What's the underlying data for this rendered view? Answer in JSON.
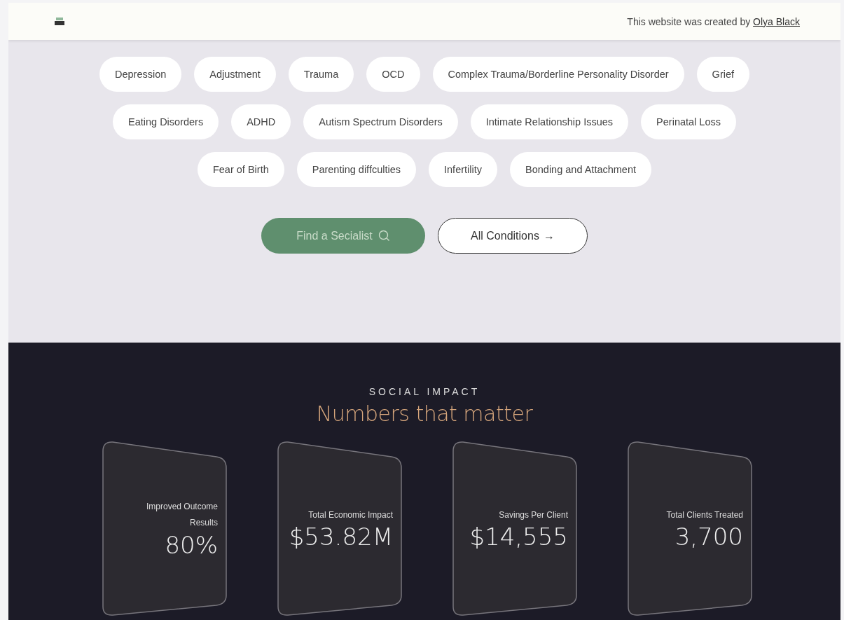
{
  "header": {
    "credit": "This website was created by",
    "credit_link": "Olya Black"
  },
  "conditions": {
    "tags": [
      "Depression",
      "Adjustment",
      "Trauma",
      "OCD",
      "Complex Trauma/Borderline Personality Disorder",
      "Grief",
      "Eating Disorders",
      "ADHD",
      "Autism Spectrum Disorders",
      "Intimate Relationship Issues",
      "Perinatal Loss",
      "Fear of Birth",
      "Parenting diffculties",
      "Infertility",
      "Bonding and Attachment"
    ],
    "primary_button": "Find a Secialist",
    "secondary_button": "All Conditions",
    "secondary_arrow": "→"
  },
  "impact": {
    "eyebrow": "SOCIAL IMPACT",
    "title": "Numbers that matter",
    "cards": [
      {
        "label": "Improved Outcome Results",
        "value": "80%"
      },
      {
        "label": "Total Economic Impact",
        "value": "$53.82M"
      },
      {
        "label": "Savings Per Client",
        "value": "$14,555"
      },
      {
        "label": "Total Clients Treated",
        "value": "3,700"
      }
    ]
  }
}
